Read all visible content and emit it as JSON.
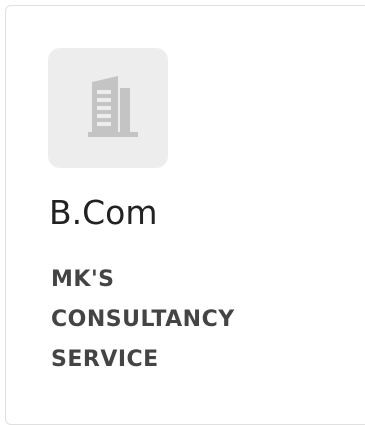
{
  "card": {
    "logo_icon": "building-icon",
    "title": "B.Com",
    "company_lines": [
      "MK'S",
      "CONSULTANCY",
      "SERVICE"
    ]
  },
  "colors": {
    "border": "#e0e0e0",
    "logo_bg": "#ededed",
    "icon": "#c4c4c4",
    "title": "#222222",
    "company": "#444444"
  }
}
